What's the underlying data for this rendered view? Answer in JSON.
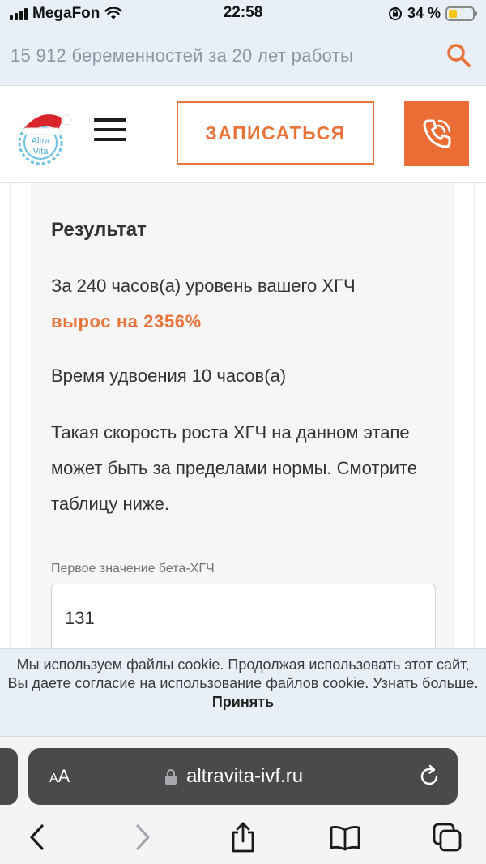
{
  "status_bar": {
    "carrier": "MegaFon",
    "time": "22:58",
    "battery_percent": "34 %",
    "battery_level": 0.34
  },
  "info_bar": {
    "text": "15 912 беременностей за 20 лет работы",
    "search_icon": "search-icon"
  },
  "header": {
    "logo_text_1": "Altra",
    "logo_text_2": "Vita",
    "signup_label": "ЗАПИСАТЬСЯ",
    "phone_icon": "phone-icon",
    "menu_icon": "hamburger-menu-icon"
  },
  "result": {
    "title": "Результат",
    "line1": "За 240 часов(а) уровень вашего ХГЧ",
    "line1_accent": "вырос на 2356%",
    "line2": "Время удвоения 10 часов(а)",
    "line3": "Такая скорость роста ХГЧ на данном этапе может быть за пределами нормы. Смотрите таблицу ниже."
  },
  "form": {
    "first_value_label": "Первое значение бета-ХГЧ",
    "first_value": "131"
  },
  "cookie": {
    "text": "Мы используем файлы cookie. Продолжая использовать этот сайт, Вы даете согласие на использование файлов cookie. Узнать больше.",
    "accept_label": "Принять"
  },
  "browser": {
    "aa_small": "A",
    "aa_large": "A",
    "url": "altravita-ivf.ru"
  },
  "colors": {
    "accent": "#e8743b",
    "phone_button": "#eb6c35",
    "info_bg": "#e9eff7",
    "url_pill": "#4a4a4c"
  }
}
